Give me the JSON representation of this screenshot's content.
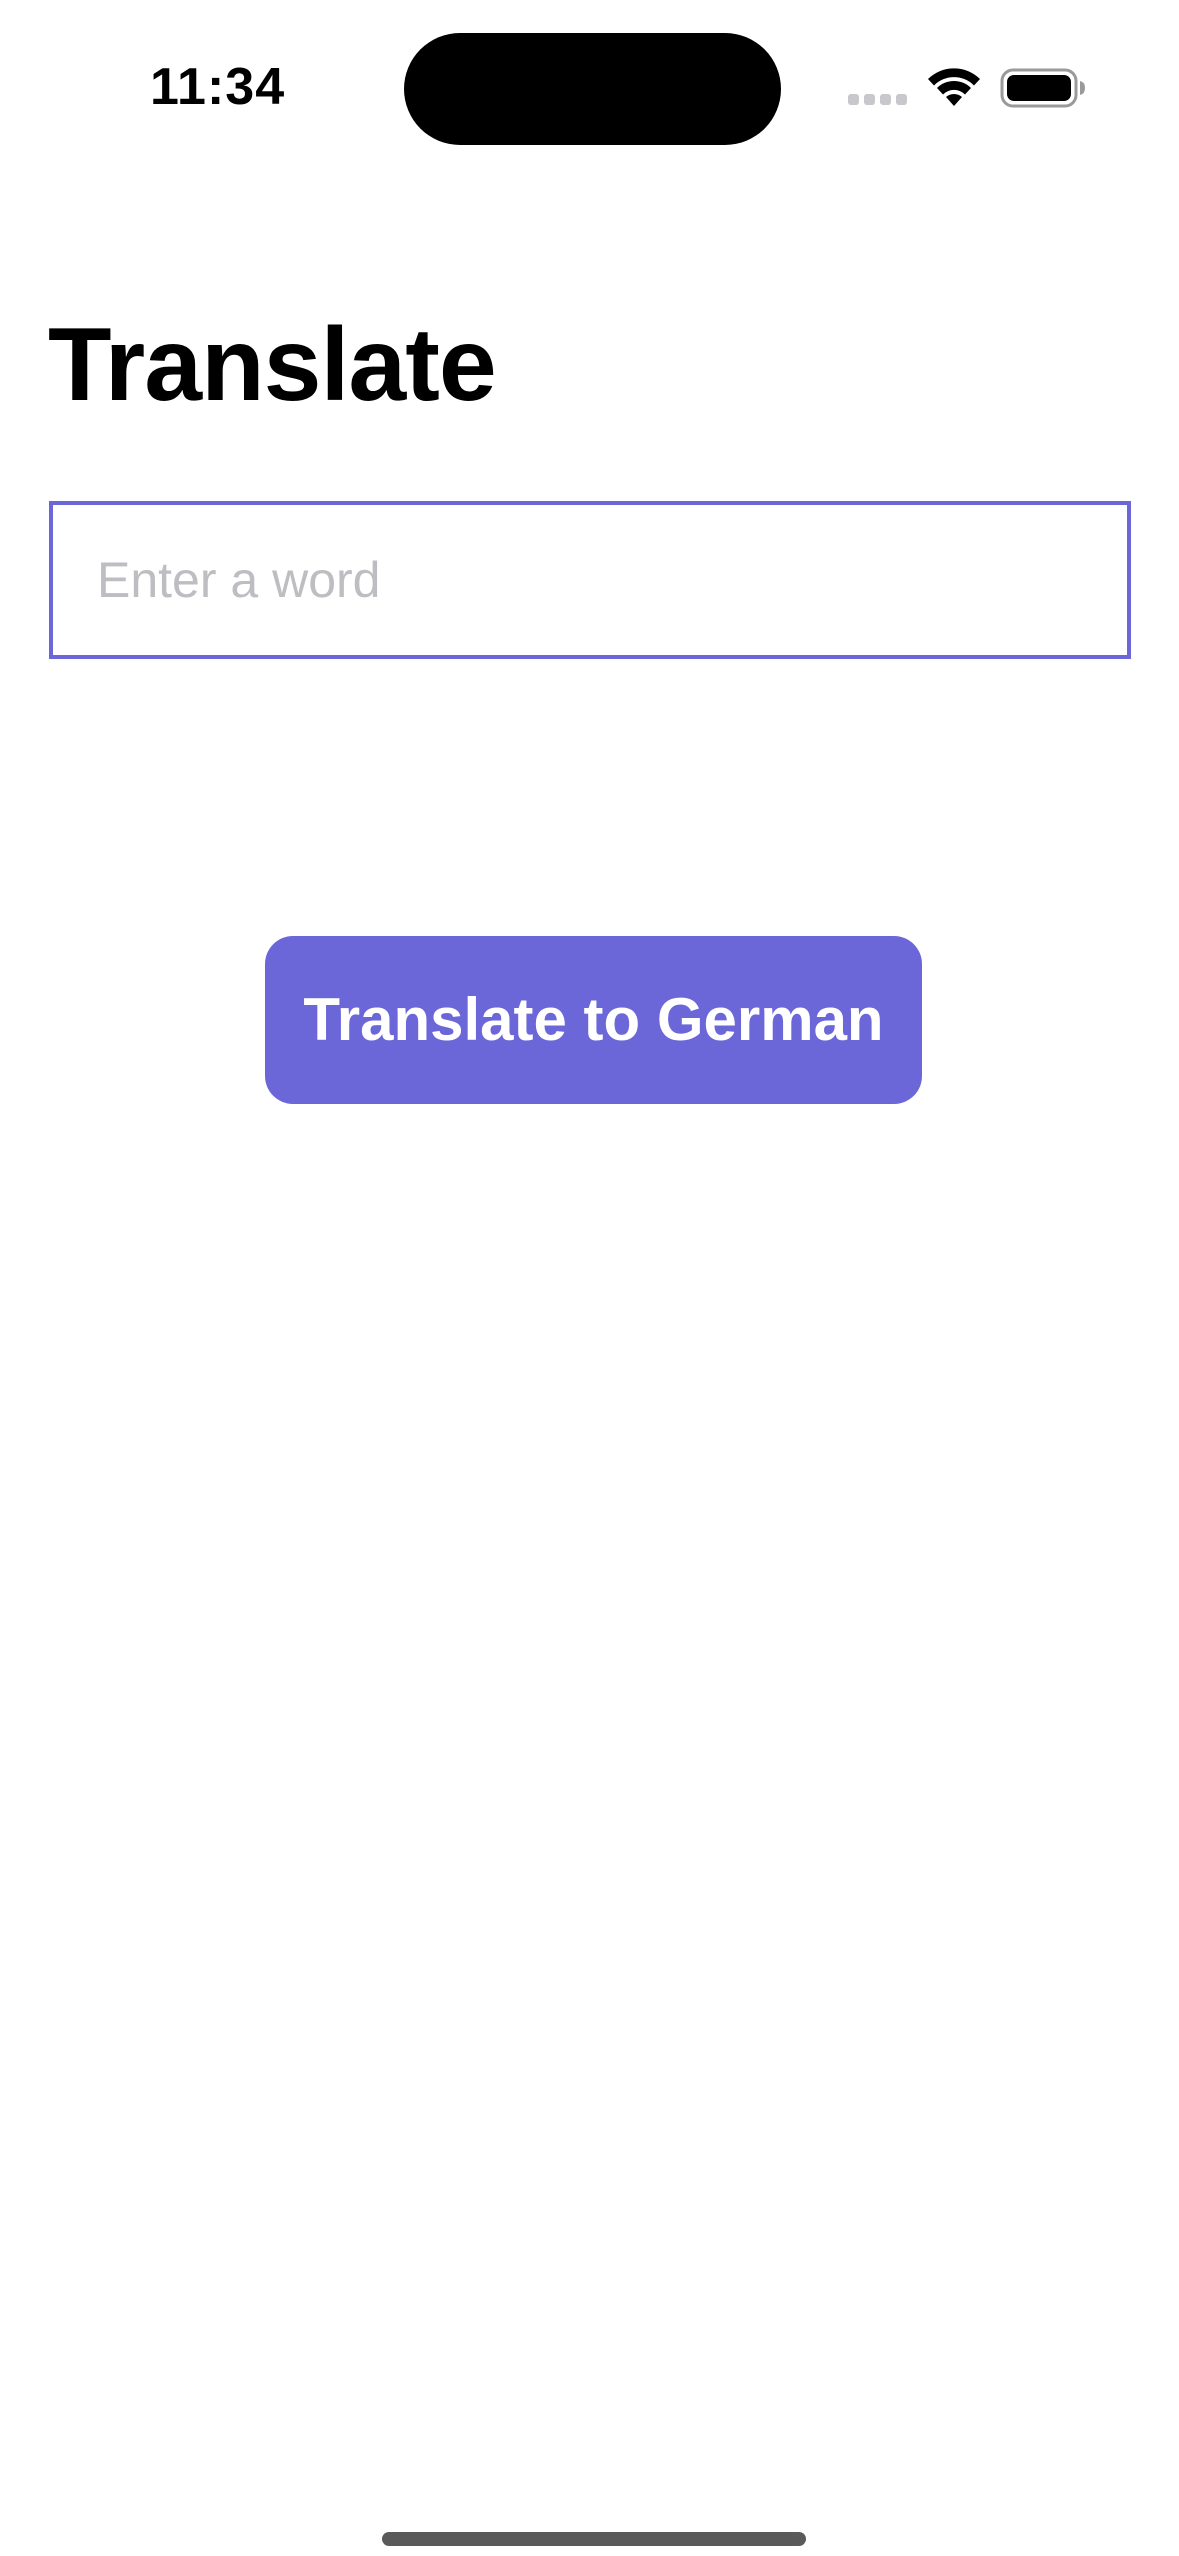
{
  "status_bar": {
    "time": "11:34",
    "icons": [
      "cellular-signal-icon",
      "wifi-icon",
      "battery-icon"
    ]
  },
  "page": {
    "title": "Translate"
  },
  "input": {
    "placeholder": "Enter a word",
    "value": ""
  },
  "actions": {
    "translate_label": "Translate to German"
  },
  "colors": {
    "accent": "#6b67d9",
    "placeholder": "#bdbdc2",
    "background": "#ffffff",
    "text": "#000000"
  }
}
